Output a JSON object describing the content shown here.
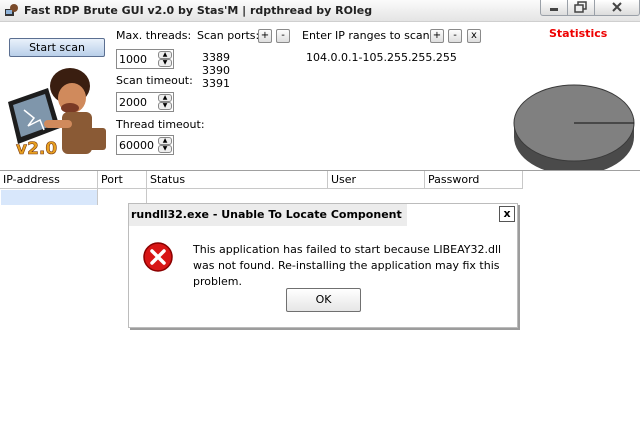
{
  "window": {
    "title": "Fast RDP Brute GUI v2.0 by Stas'M | rdpthread by ROleg"
  },
  "toolbar": {
    "start_scan_label": "Start scan",
    "mascot_badge": "v2.0",
    "max_threads_label": "Max. threads:",
    "max_threads_value": "1000",
    "scan_timeout_label": "Scan timeout:",
    "scan_timeout_value": "2000",
    "thread_timeout_label": "Thread timeout:",
    "thread_timeout_value": "60000",
    "scan_ports_label": "Scan ports:",
    "scan_ports": [
      "3389",
      "3390",
      "3391"
    ],
    "ip_ranges_label": "Enter IP ranges to scan:",
    "ip_ranges": [
      "104.0.0.1-105.255.255.255"
    ],
    "add_symbol": "+",
    "remove_symbol": "-",
    "clear_symbol": "x"
  },
  "statistics": {
    "title": "Statistics",
    "title_color": "#ee0000",
    "pie_color": "#808080"
  },
  "grid": {
    "columns": [
      "IP-address",
      "Port",
      "Status",
      "User",
      "Password"
    ]
  },
  "dialog": {
    "title": "rundll32.exe - Unable To Locate Component",
    "close_symbol": "x",
    "message": "This application has failed to start because LIBEAY32.dll was not found. Re-installing the application may fix this problem.",
    "ok_label": "OK",
    "icon": "error-icon"
  }
}
